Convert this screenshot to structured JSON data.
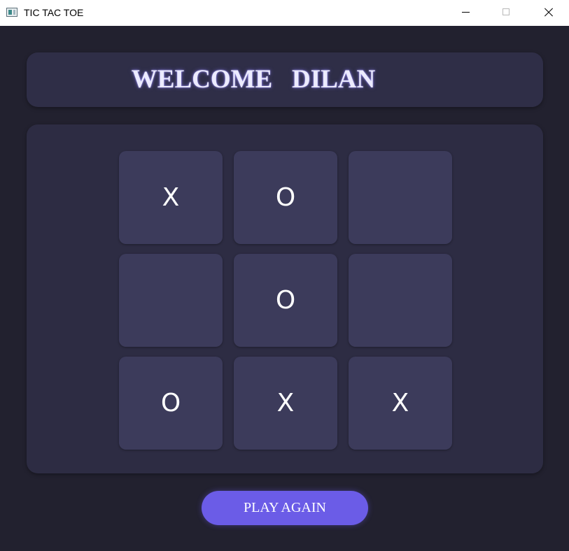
{
  "window": {
    "title": "TIC TAC TOE",
    "icon": "app-window-icon"
  },
  "header": {
    "welcome_text": "WELCOME   DILAN"
  },
  "board": {
    "cells": [
      "X",
      "O",
      "",
      "",
      "O",
      "",
      "O",
      "X",
      "X"
    ]
  },
  "actions": {
    "play_again_label": "PLAY AGAIN"
  },
  "colors": {
    "background": "#22212f",
    "panel": "#2f2e47",
    "cell": "#3c3b5b",
    "accent": "#6b5ce7",
    "text": "#ffffff"
  }
}
